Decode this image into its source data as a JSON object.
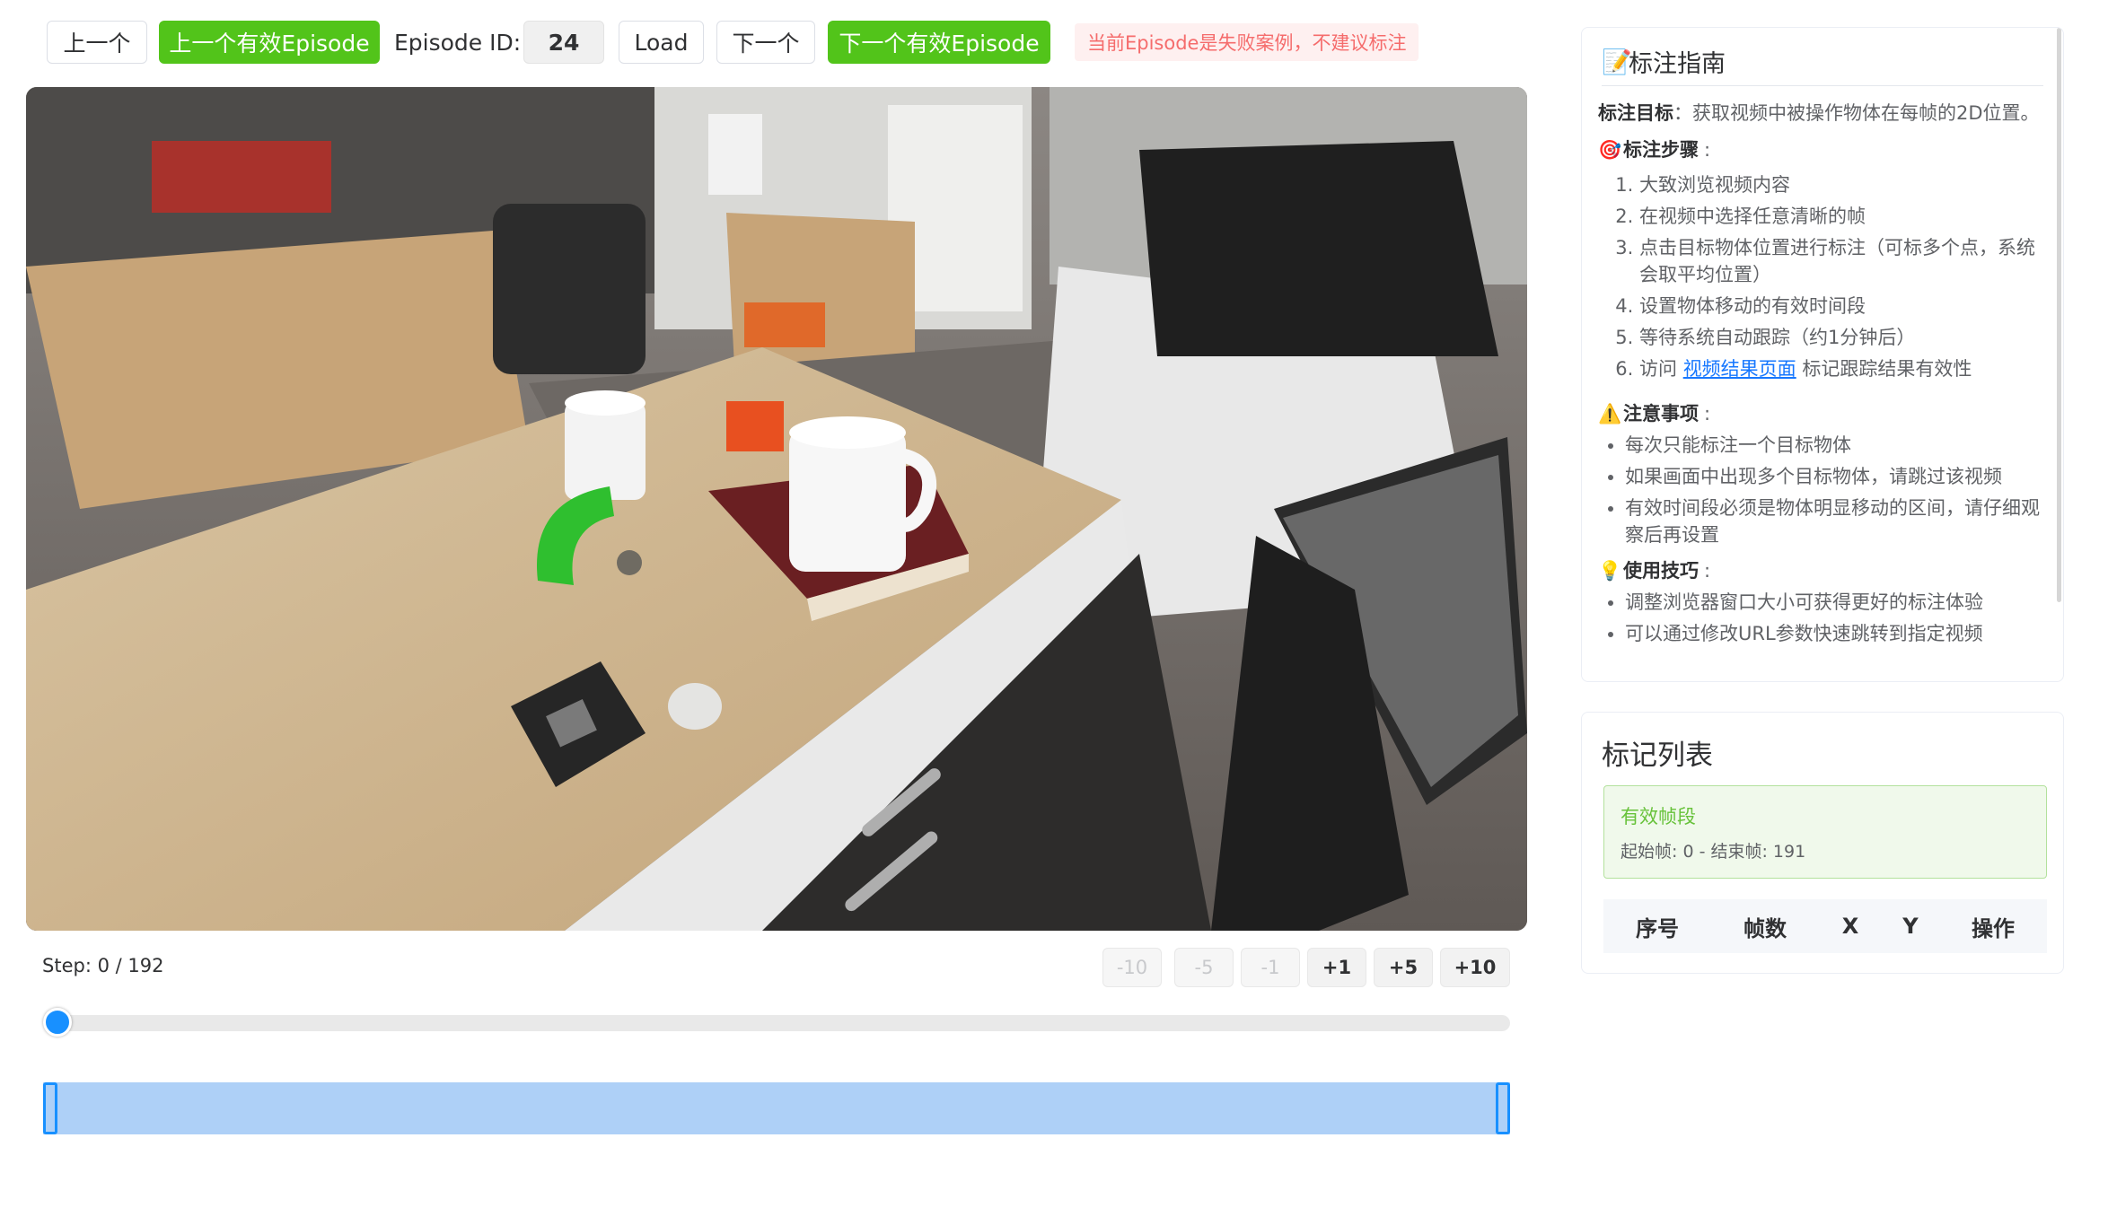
{
  "toolbar": {
    "prev_label": "上一个",
    "prev_valid_label": "上一个有效Episode",
    "episode_label": "Episode ID:",
    "episode_id": "24",
    "load_label": "Load",
    "next_label": "下一个",
    "next_valid_label": "下一个有效Episode",
    "warning": "当前Episode是失败案例，不建议标注"
  },
  "player": {
    "step_prefix": "Step:",
    "current_step": 0,
    "total_steps": 192,
    "step_text": "Step: 0 / 192",
    "buttons": [
      "-10",
      "-5",
      "-1",
      "+1",
      "+5",
      "+10"
    ],
    "slider_fraction": 0.0,
    "range_start_fraction": 0.0,
    "range_end_fraction": 1.0
  },
  "guide": {
    "title": "标注指南",
    "goal_label": "标注目标",
    "goal_text": "：获取视频中被操作物体在每帧的2D位置。",
    "steps_label": "标注步骤",
    "steps": [
      "大致浏览视频内容",
      "在视频中选择任意清晰的帧",
      "点击目标物体位置进行标注（可标多个点，系统会取平均位置）",
      "设置物体移动的有效时间段",
      "等待系统自动跟踪（约1分钟后）"
    ],
    "step6_prefix": "访问",
    "step6_link": "视频结果页面",
    "step6_suffix": "标记跟踪结果有效性",
    "notes_label": "注意事项",
    "notes": [
      "每次只能标注一个目标物体",
      "如果画面中出现多个目标物体，请跳过该视频",
      "有效时间段必须是物体明显移动的区间，请仔细观察后再设置"
    ],
    "tips_label": "使用技巧",
    "tips": [
      "调整浏览器窗口大小可获得更好的标注体验",
      "可以通过修改URL参数快速跳转到指定视频"
    ]
  },
  "marks": {
    "title": "标记列表",
    "valid_title": "有效帧段",
    "valid_range": "起始帧: 0 - 结束帧: 191",
    "columns": [
      "序号",
      "帧数",
      "X",
      "Y",
      "操作"
    ]
  },
  "colors": {
    "accent_green": "#52c41a",
    "accent_blue": "#1890ff",
    "warning_red": "#f56c6c",
    "range_fill": "#aed0f7"
  }
}
